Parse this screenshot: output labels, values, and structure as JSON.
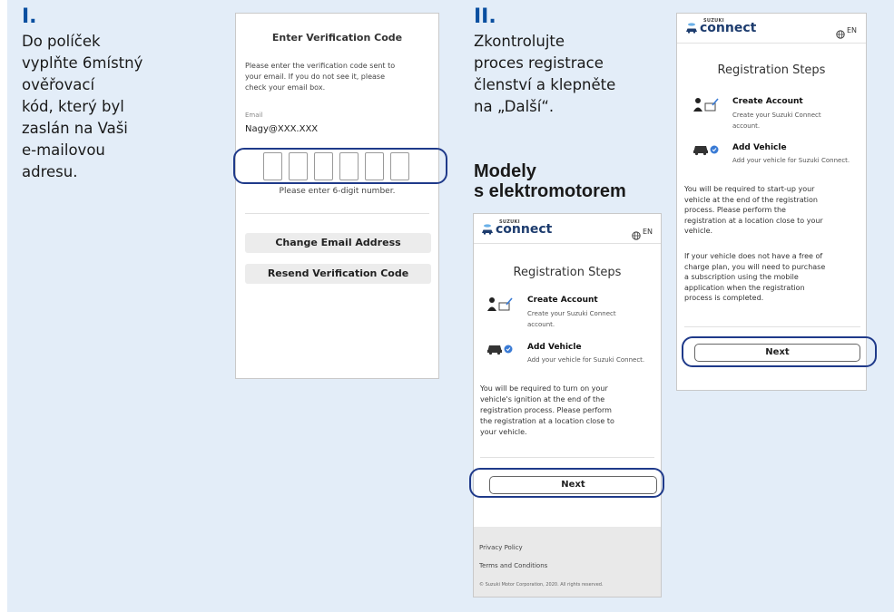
{
  "step1": {
    "number": "I.",
    "text": [
      "Do políček",
      "vyplňte 6místný",
      "ověřovací",
      "kód, který byl",
      "zaslán na Vaši",
      "e-mailovou",
      "adresu."
    ]
  },
  "step2": {
    "number": "II.",
    "text": [
      "Zkontrolujte",
      "proces registrace",
      "členství a klepněte",
      "na „Další“."
    ],
    "ev_heading": [
      "Modely",
      "s elektromotorem"
    ]
  },
  "verify": {
    "title": "Enter Verification Code",
    "instructions": [
      "Please enter the verification code sent to",
      "your email. If you do not see it, please",
      "check your email box."
    ],
    "email_label": "Email",
    "email_value": "Nagy@XXX.XXX",
    "hint": "Please enter 6-digit number.",
    "change_email": "Change Email Address",
    "resend": "Resend Verification Code"
  },
  "brand": {
    "top": "SUZUKI",
    "main": "connect",
    "lang": "EN"
  },
  "reg": {
    "title": "Registration Steps",
    "create_title": "Create Account",
    "create_desc": [
      "Create your Suzuki Connect",
      "account."
    ],
    "add_title": "Add Vehicle",
    "add_desc": "Add your vehicle for Suzuki Connect.",
    "next": "Next"
  },
  "ev_phone": {
    "para": [
      "You will be required to turn on your",
      "vehicle's ignition at the end of the",
      "registration process. Please perform",
      "the registration at a location close to",
      "your vehicle."
    ],
    "footer": [
      "Privacy Policy",
      "Terms and Conditions",
      "© Suzuki Motor Corporation, 2020. All rights reserved."
    ]
  },
  "std_phone": {
    "para1": [
      "You will be required to start-up your",
      "vehicle at the end of the registration",
      "process. Please perform the",
      "registration at a location close to your",
      "vehicle."
    ],
    "para2": [
      "If your vehicle does not have a free of",
      "charge plan, you will need to purchase",
      "a subscription using the mobile",
      "application when the registration",
      "process is completed."
    ]
  },
  "colors": {
    "panel": "#e3edf8",
    "accent": "#0a4fa0",
    "highlight": "#1f3a8a"
  },
  "icons": [
    "person-card-icon",
    "car-check-icon",
    "globe-icon",
    "car-logo-icon"
  ]
}
